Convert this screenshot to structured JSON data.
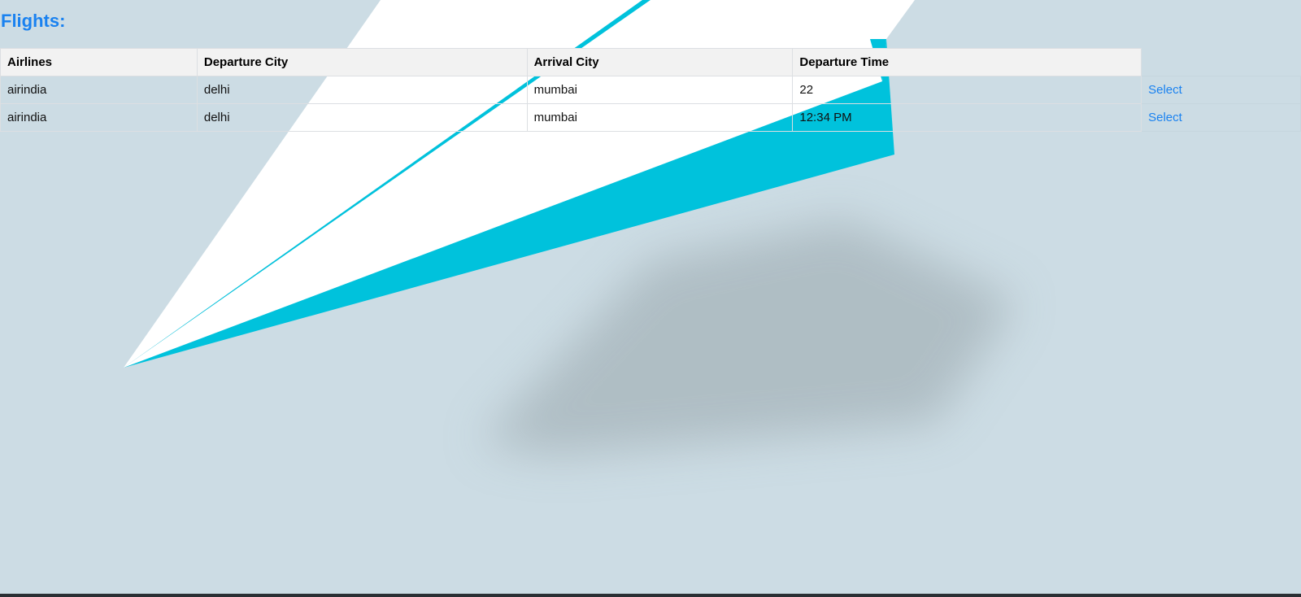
{
  "page": {
    "title": "Flights:"
  },
  "table": {
    "headers": [
      "Airlines",
      "Departure City",
      "Arrival City",
      "Departure Time"
    ],
    "rows": [
      {
        "airline": "airindia",
        "departure_city": "delhi",
        "arrival_city": "mumbai",
        "departure_time": "22",
        "action": "Select"
      },
      {
        "airline": "airindia",
        "departure_city": "delhi",
        "arrival_city": "mumbai",
        "departure_time": "12:34 PM",
        "action": "Select"
      }
    ]
  },
  "colors": {
    "accent": "#1a82f0",
    "background": "#ccdce4",
    "plane_blue": "#00c2dc",
    "plane_white": "#ffffff",
    "header_bg": "#f2f2f2"
  },
  "icons": {
    "background": "paper-plane-illustration"
  }
}
